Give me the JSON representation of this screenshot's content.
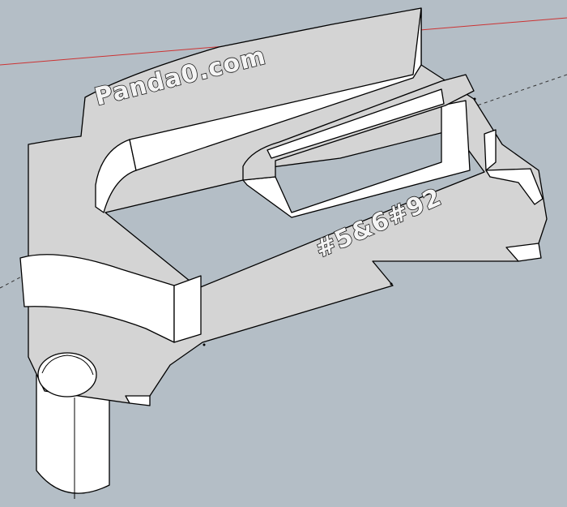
{
  "viewport": {
    "background_color": "#b4bec6",
    "face_top_color": "#d4d4d4",
    "face_side_color": "#ffffff",
    "edge_color": "#000000",
    "red_axis_color": "#cc3333",
    "green_axis_color": "#3c8a3c",
    "inference_line_color": "#333333"
  },
  "model": {
    "engraved_text_top": "Panda0.com",
    "engraved_text_bottom": "#5&6#92"
  }
}
